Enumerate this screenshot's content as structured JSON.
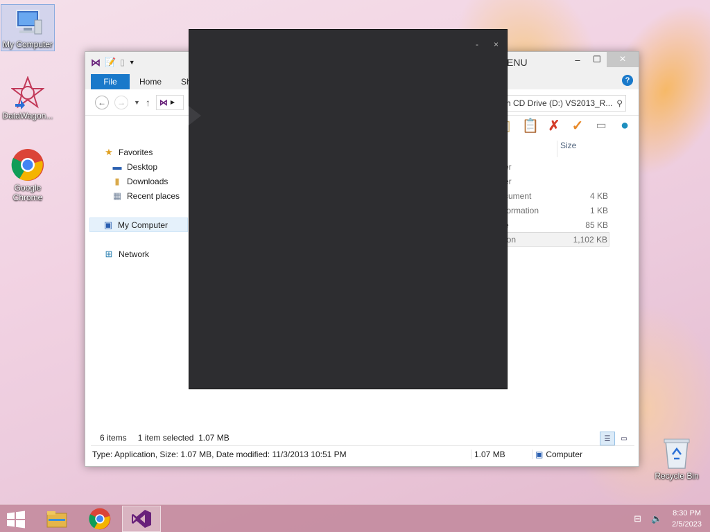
{
  "desktop": {
    "icons": [
      {
        "label": "My Computer",
        "icon": "computer-icon"
      },
      {
        "label": "DataWagon...",
        "icon": "datawagon-icon"
      },
      {
        "label": "Google Chrome",
        "icon": "chrome-icon"
      }
    ],
    "recycle_bin": {
      "label": "Recycle Bin",
      "icon": "recycle-bin-icon"
    }
  },
  "explorer": {
    "title_partial": "ENU",
    "tabs": {
      "file": "File",
      "home": "Home",
      "share": "Sh"
    },
    "search_placeholder": "ch CD Drive (D:) VS2013_R...",
    "nav": {
      "favorites": "Favorites",
      "desktop": "Desktop",
      "downloads": "Downloads",
      "recent": "Recent places",
      "my_computer": "My Computer",
      "network": "Network"
    },
    "column_size": "Size",
    "rows": [
      {
        "type": "er",
        "size": ""
      },
      {
        "type": "er",
        "size": ""
      },
      {
        "type": "cument",
        "size": "4 KB"
      },
      {
        "type": "formation",
        "size": "1 KB"
      },
      {
        "type": "e",
        "size": "85 KB"
      },
      {
        "type": "ion",
        "size": "1,102 KB"
      }
    ],
    "status": {
      "items": "6 items",
      "selected": "1 item selected",
      "sel_size": "1.07 MB"
    },
    "details": {
      "info": "Type: Application, Size: 1.07 MB, Date modified: 11/3/2013 10:51 PM",
      "size": "1.07 MB",
      "location": "Computer"
    }
  },
  "dark_window": {
    "minimize": "-",
    "close": "×"
  },
  "taskbar": {
    "time": "8:30 PM",
    "date": "2/5/2023"
  },
  "colors": {
    "ribbon_blue": "#1979ca",
    "vs_purple": "#68217a",
    "dark_window": "#2d2d30"
  }
}
